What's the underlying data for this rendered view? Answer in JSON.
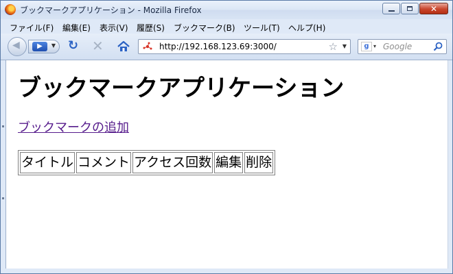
{
  "window": {
    "title": "ブックマークアプリケーション - Mozilla Firefox"
  },
  "menu": {
    "items": [
      "ファイル(F)",
      "編集(E)",
      "表示(V)",
      "履歴(S)",
      "ブックマーク(B)",
      "ツール(T)",
      "ヘルプ(H)"
    ]
  },
  "toolbar": {
    "url": "http://192.168.123.69:3000/",
    "search_placeholder": "Google"
  },
  "page": {
    "heading": "ブックマークアプリケーション",
    "add_link": "ブックマークの追加",
    "table_headers": [
      "タイトル",
      "コメント",
      "アクセス回数",
      "編集",
      "削除"
    ]
  },
  "colors": {
    "link_visited": "#551a8b",
    "reload_blue": "#2b62c4"
  }
}
